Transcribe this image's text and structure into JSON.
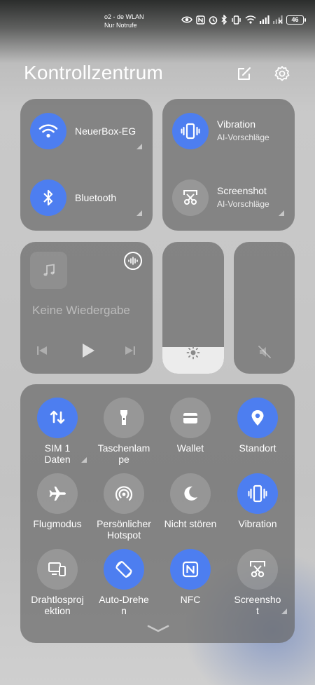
{
  "status_bar": {
    "carrier_line1": "o2 - de WLAN",
    "carrier_line2": "Nur Notrufe",
    "battery": "46",
    "icons": [
      "eye-icon",
      "nfc-icon",
      "alarm-icon",
      "bluetooth-icon",
      "vibrate-icon",
      "wifi-icon",
      "signal-icon",
      "signal-no-sim-icon",
      "battery-icon"
    ]
  },
  "header": {
    "title": "Kontrollzentrum",
    "edit_icon": "edit-icon",
    "settings_icon": "gear-icon"
  },
  "connectivity": {
    "wifi": {
      "label": "NeuerBox-EG",
      "icon": "wifi-icon",
      "active": true
    },
    "bluetooth": {
      "label": "Bluetooth",
      "icon": "bluetooth-icon",
      "active": true
    }
  },
  "quick_top": {
    "vibration": {
      "label": "Vibration",
      "sub": "AI-Vorschläge",
      "icon": "vibrate-icon",
      "active": true
    },
    "screenshot": {
      "label": "Screenshot",
      "sub": "AI-Vorschläge",
      "icon": "scissors-icon",
      "active": false
    }
  },
  "media": {
    "status": "Keine Wiedergabe",
    "icons": [
      "music-note-icon",
      "audio-output-icon",
      "previous-icon",
      "play-icon",
      "next-icon"
    ]
  },
  "sliders": {
    "brightness_level": 0.2,
    "volume_level": 0.0,
    "brightness_icon": "sun-icon",
    "volume_icon": "muted-icon"
  },
  "toggles": [
    {
      "label": "SIM 1\nDaten",
      "icon": "data-arrows-icon",
      "active": true
    },
    {
      "label": "Taschenlam\npe",
      "icon": "flashlight-icon",
      "active": false
    },
    {
      "label": "Wallet",
      "icon": "wallet-icon",
      "active": false
    },
    {
      "label": "Standort",
      "icon": "location-icon",
      "active": true
    },
    {
      "label": "Flugmodus",
      "icon": "airplane-icon",
      "active": false
    },
    {
      "label": "Persönlicher\nHotspot",
      "icon": "hotspot-icon",
      "active": false
    },
    {
      "label": "Nicht stören",
      "icon": "moon-icon",
      "active": false
    },
    {
      "label": "Vibration",
      "icon": "vibrate-icon",
      "active": true
    },
    {
      "label": "Drahtlosproj\nektion",
      "icon": "cast-icon",
      "active": false
    },
    {
      "label": "Auto-Drehe\nn",
      "icon": "rotate-icon",
      "active": true
    },
    {
      "label": "NFC",
      "icon": "nfc-icon",
      "active": true
    },
    {
      "label": "Screensho\nt",
      "icon": "scissors-icon",
      "active": false
    }
  ],
  "colors": {
    "accent": "#4d7ef0",
    "panel": "#696969"
  }
}
